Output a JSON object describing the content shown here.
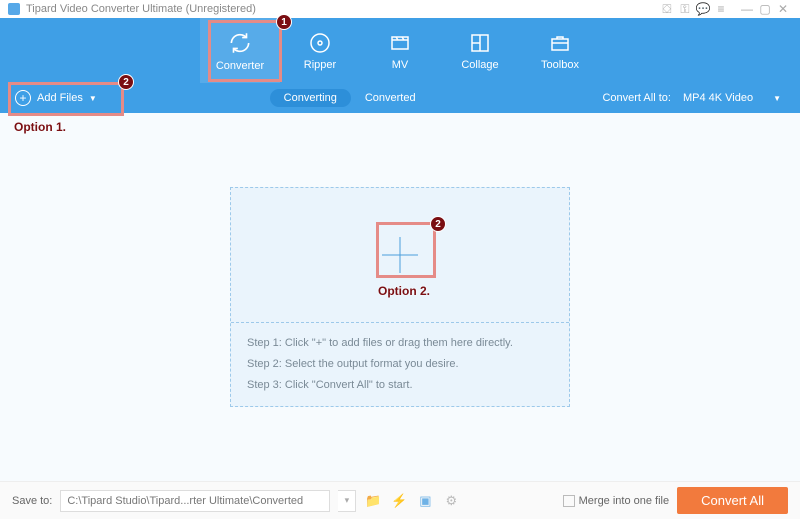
{
  "titlebar": {
    "app_name": "Tipard Video Converter Ultimate (Unregistered)"
  },
  "header": {
    "tabs": {
      "converter": "Converter",
      "ripper": "Ripper",
      "mv": "MV",
      "collage": "Collage",
      "toolbox": "Toolbox"
    }
  },
  "subbar": {
    "add_files": "Add Files",
    "converting": "Converting",
    "converted": "Converted",
    "convert_all_to": "Convert All to:",
    "selected_format": "MP4 4K Video"
  },
  "dropzone": {
    "step1": "Step 1: Click \"+\" to add files or drag them here directly.",
    "step2": "Step 2: Select the output format you desire.",
    "step3": "Step 3: Click \"Convert All\" to start."
  },
  "bottombar": {
    "save_to_label": "Save to:",
    "path": "C:\\Tipard Studio\\Tipard...rter Ultimate\\Converted",
    "merge": "Merge into one file",
    "convert_all": "Convert All"
  },
  "annotations": {
    "badge1": "1",
    "badge2": "2",
    "option1": "Option 1.",
    "option2": "Option 2."
  }
}
